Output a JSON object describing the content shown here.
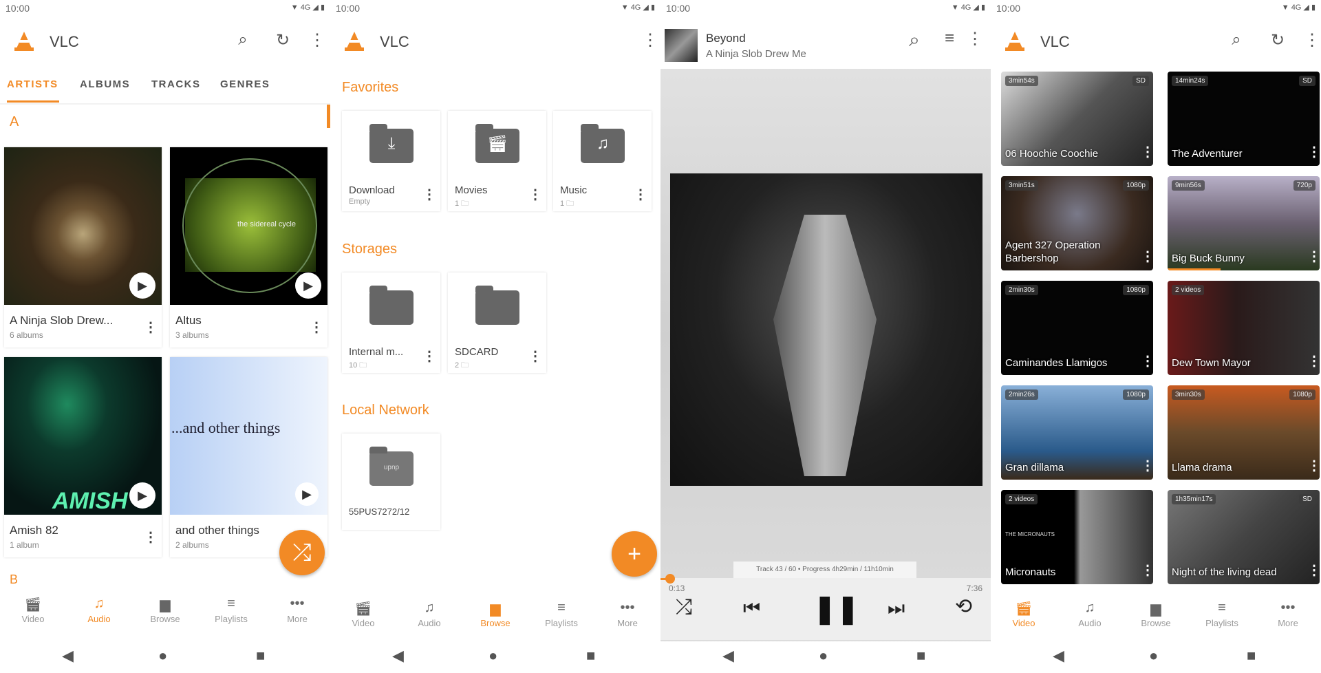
{
  "status": {
    "time": "10:00",
    "network": "4G"
  },
  "accent": "#f28a25",
  "app": {
    "title": "VLC"
  },
  "bottom_nav": [
    "Video",
    "Audio",
    "Browse",
    "Playlists",
    "More"
  ],
  "audio": {
    "tabs": [
      "ARTISTS",
      "ALBUMS",
      "TRACKS",
      "GENRES"
    ],
    "sections": [
      "A",
      "B"
    ],
    "artists": [
      {
        "name": "A Ninja Slob Drew...",
        "count": "6 albums"
      },
      {
        "name": "Altus",
        "count": "3 albums",
        "art_text": "the sidereal cycle"
      },
      {
        "name": "Amish 82",
        "count": "1 album",
        "art_text": "AMISH"
      },
      {
        "name": "and other things",
        "count": "2 albums",
        "art_text": "...and other things"
      }
    ]
  },
  "browse": {
    "sections": [
      "Favorites",
      "Storages",
      "Local Network"
    ],
    "favorites": [
      {
        "name": "Download",
        "sub": "Empty"
      },
      {
        "name": "Movies",
        "sub": "1 🗀"
      },
      {
        "name": "Music",
        "sub": "1 🗀"
      }
    ],
    "storages": [
      {
        "name": "Internal m...",
        "sub": "10 🗀"
      },
      {
        "name": "SDCARD",
        "sub": "2 🗀"
      }
    ],
    "network": [
      {
        "name": "55PUS7272/12",
        "badge": "upnp"
      }
    ]
  },
  "player": {
    "title": "Beyond",
    "artist": "A Ninja Slob Drew Me",
    "overlay": "Track 43 / 60 • Progress 4h29min / 11h10min",
    "elapsed": "0:13",
    "duration": "7:36",
    "progress": 0.03
  },
  "video": {
    "items": [
      {
        "title": "06 Hoochie Coochie",
        "duration": "3min54s",
        "quality": "SD"
      },
      {
        "title": "The Adventurer",
        "duration": "14min24s",
        "quality": "SD"
      },
      {
        "title": "Agent 327 Operation Barbershop",
        "duration": "3min51s",
        "quality": "1080p"
      },
      {
        "title": "Big Buck Bunny",
        "duration": "9min56s",
        "quality": "720p",
        "progress": 0.35
      },
      {
        "title": "Caminandes Llamigos",
        "duration": "2min30s",
        "quality": "1080p"
      },
      {
        "title": "Dew Town Mayor",
        "duration": "2 videos",
        "quality": ""
      },
      {
        "title": "Gran dillama",
        "duration": "2min26s",
        "quality": "1080p"
      },
      {
        "title": "Llama drama",
        "duration": "3min30s",
        "quality": "1080p"
      },
      {
        "title": "Micronauts",
        "duration": "2 videos",
        "quality": "",
        "art_text": "THE MICRONAUTS"
      },
      {
        "title": "Night of the living dead",
        "duration": "1h35min17s",
        "quality": "SD"
      }
    ]
  }
}
